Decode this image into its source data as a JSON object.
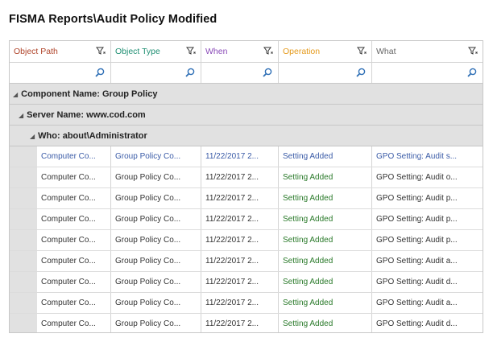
{
  "title": "FISMA Reports\\Audit Policy Modified",
  "columns": [
    {
      "label": "Object Path",
      "color": "#b0452b"
    },
    {
      "label": "Object Type",
      "color": "#1f8f73"
    },
    {
      "label": "When",
      "color": "#8a4bb8"
    },
    {
      "label": "Operation",
      "color": "#e59a1c"
    },
    {
      "label": "What",
      "color": "#666666"
    }
  ],
  "groups": {
    "component": "Component Name: Group Policy",
    "server": "Server Name: www.cod.com",
    "who": "Who: about\\Administrator"
  },
  "rows": [
    {
      "path": "Computer Co...",
      "type": "Group Policy Co...",
      "when": "11/22/2017 2...",
      "op": "Setting Added",
      "what": "GPO Setting: Audit s..."
    },
    {
      "path": "Computer Co...",
      "type": "Group Policy Co...",
      "when": "11/22/2017 2...",
      "op": "Setting Added",
      "what": "GPO Setting: Audit o..."
    },
    {
      "path": "Computer Co...",
      "type": "Group Policy Co...",
      "when": "11/22/2017 2...",
      "op": "Setting Added",
      "what": "GPO Setting: Audit p..."
    },
    {
      "path": "Computer Co...",
      "type": "Group Policy Co...",
      "when": "11/22/2017 2...",
      "op": "Setting Added",
      "what": "GPO Setting: Audit p..."
    },
    {
      "path": "Computer Co...",
      "type": "Group Policy Co...",
      "when": "11/22/2017 2...",
      "op": "Setting Added",
      "what": "GPO Setting: Audit p..."
    },
    {
      "path": "Computer Co...",
      "type": "Group Policy Co...",
      "when": "11/22/2017 2...",
      "op": "Setting Added",
      "what": "GPO Setting: Audit a..."
    },
    {
      "path": "Computer Co...",
      "type": "Group Policy Co...",
      "when": "11/22/2017 2...",
      "op": "Setting Added",
      "what": "GPO Setting: Audit d..."
    },
    {
      "path": "Computer Co...",
      "type": "Group Policy Co...",
      "when": "11/22/2017 2...",
      "op": "Setting Added",
      "what": "GPO Setting: Audit a..."
    },
    {
      "path": "Computer Co...",
      "type": "Group Policy Co...",
      "when": "11/22/2017 2...",
      "op": "Setting Added",
      "what": "GPO Setting: Audit d..."
    }
  ],
  "icons": {
    "filter": "filter-icon",
    "search": "search-icon",
    "expand": "collapse-triangle-icon"
  },
  "colors": {
    "group_bg": "#e1e1e1",
    "selected_text": "#3a5ba7",
    "operation_text": "#2a7a2a"
  }
}
